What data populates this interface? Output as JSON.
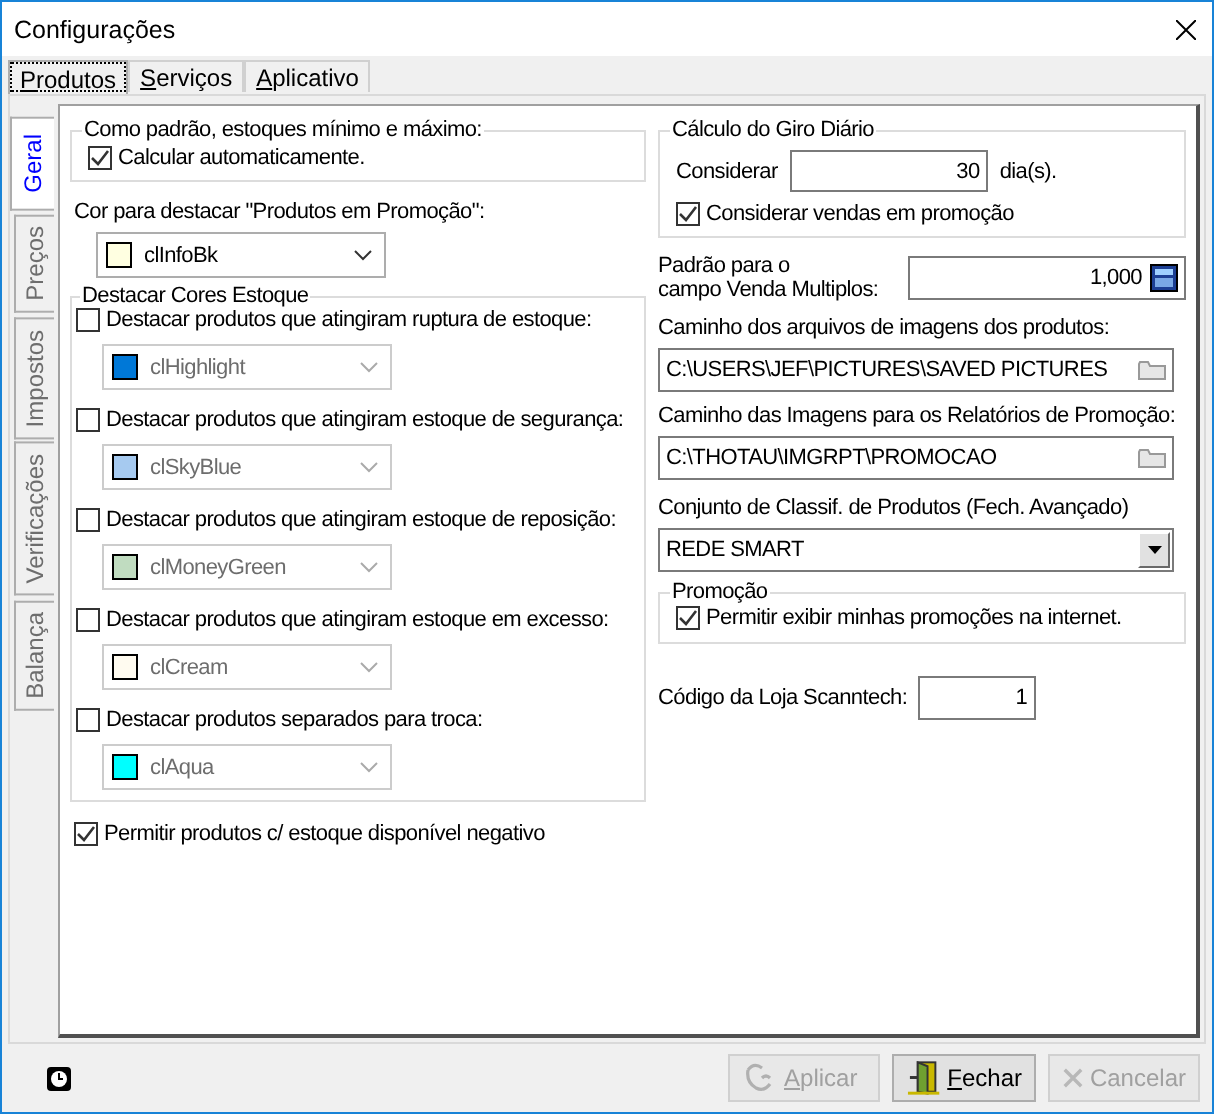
{
  "window": {
    "title": "Configurações"
  },
  "top_tabs": [
    {
      "label": "Produtos",
      "selected": true
    },
    {
      "label": "Serviços",
      "selected": false
    },
    {
      "label": "Aplicativo",
      "selected": false
    }
  ],
  "side_tabs": [
    {
      "label": "Geral",
      "selected": true
    },
    {
      "label": "Preços",
      "selected": false
    },
    {
      "label": "Impostos",
      "selected": false
    },
    {
      "label": "Verificações",
      "selected": false
    },
    {
      "label": "Balança",
      "selected": false
    }
  ],
  "min_max_group": {
    "title": "Como padrão, estoques mínimo e máximo:",
    "checkbox": {
      "label": "Calcular automaticamente.",
      "checked": true
    }
  },
  "promo_color": {
    "label": "Cor para destacar \"Produtos em Promoção\":",
    "combo": {
      "value": "clInfoBk",
      "color": "#ffffe1",
      "disabled": false
    }
  },
  "stock_colors": {
    "title": "Destacar Cores Estoque",
    "items": [
      {
        "label": "Destacar produtos que atingiram ruptura de estoque:",
        "checked": false,
        "combo": {
          "value": "clHighlight",
          "color": "#0078d7",
          "disabled": true
        }
      },
      {
        "label": "Destacar produtos que atingiram estoque de segurança:",
        "checked": false,
        "combo": {
          "value": "clSkyBlue",
          "color": "#a6caf0",
          "disabled": true
        }
      },
      {
        "label": "Destacar produtos que atingiram estoque de reposição:",
        "checked": false,
        "combo": {
          "value": "clMoneyGreen",
          "color": "#c0dcc0",
          "disabled": true
        }
      },
      {
        "label": "Destacar produtos que atingiram estoque em excesso:",
        "checked": false,
        "combo": {
          "value": "clCream",
          "color": "#fffbf0",
          "disabled": true
        }
      },
      {
        "label": "Destacar produtos separados para troca:",
        "checked": false,
        "combo": {
          "value": "clAqua",
          "color": "#00ffff",
          "disabled": true
        }
      }
    ]
  },
  "negative_stock": {
    "label": "Permitir produtos c/ estoque disponível negativo",
    "checked": true
  },
  "giro_group": {
    "title": "Cálculo do Giro Diário",
    "considerar_label": "Considerar",
    "days": "30",
    "unit": "dia(s).",
    "checkbox": {
      "label": "Considerar vendas em promoção",
      "checked": true
    }
  },
  "multiplos": {
    "label": "Padrão para o\ncampo Venda Multiplos:",
    "value": "1,000"
  },
  "image_path": {
    "label": "Caminho dos arquivos de imagens dos produtos:",
    "value": "C:\\USERS\\JEF\\PICTURES\\SAVED PICTURES"
  },
  "promo_image_path": {
    "label": "Caminho das Imagens para os Relatórios de Promoção:",
    "value": "C:\\THOTAU\\IMGRPT\\PROMOCAO"
  },
  "classif": {
    "label": "Conjunto de Classif. de Produtos (Fech. Avançado)",
    "value": "REDE SMART"
  },
  "promo_group": {
    "title": "Promoção",
    "checkbox": {
      "label": "Permitir exibir minhas promoções na internet.",
      "checked": true
    }
  },
  "scanntech": {
    "label": "Código da Loja Scanntech:",
    "value": "1"
  },
  "buttons": [
    {
      "kind": "apply",
      "label": "Aplicar",
      "disabled": true
    },
    {
      "kind": "close",
      "label": "Fechar",
      "disabled": false
    },
    {
      "kind": "cancel",
      "label": "Cancelar",
      "disabled": true
    }
  ]
}
